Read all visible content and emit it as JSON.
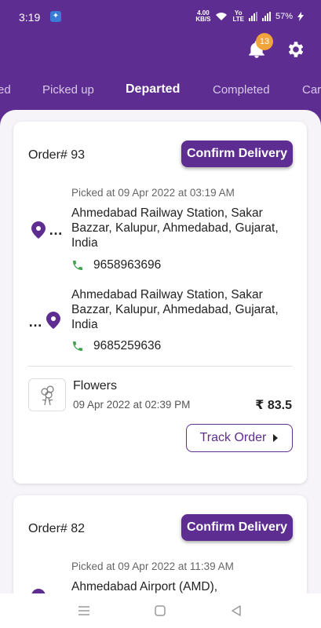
{
  "status": {
    "time": "3:19",
    "speed_top": "4.00",
    "speed_bottom": "KB/S",
    "volte_top": "Yo",
    "volte_bottom": "LTE",
    "battery": "57%"
  },
  "header": {
    "notification_count": "13"
  },
  "tabs": [
    {
      "label": "ed"
    },
    {
      "label": "Picked up"
    },
    {
      "label": "Departed"
    },
    {
      "label": "Completed"
    },
    {
      "label": "Car"
    }
  ],
  "orders": [
    {
      "order_no": "Order# 93",
      "confirm_label": "Confirm Delivery",
      "picked_at": "Picked at 09 Apr 2022 at 03:19 AM",
      "pickup": {
        "address": "Ahmedabad Railway Station, Sakar Bazzar, Kalupur, Ahmedabad, Gujarat, India",
        "phone": "9658963696"
      },
      "drop": {
        "address": "Ahmedabad Railway Station, Sakar Bazzar, Kalupur, Ahmedabad, Gujarat, India",
        "phone": "9685259636"
      },
      "item_name": "Flowers",
      "item_date": "09 Apr 2022 at 02:39 PM",
      "price": "₹ 83.5",
      "track_label": "Track Order"
    },
    {
      "order_no": "Order# 82",
      "confirm_label": "Confirm Delivery",
      "picked_at": "Picked at 09 Apr 2022 at 11:39 AM",
      "pickup": {
        "address": "Ahmedabad Airport (AMD),"
      }
    }
  ],
  "colors": {
    "brand": "#5e2d91",
    "badge": "#f0a43a",
    "phone_icon": "#3aa54a"
  }
}
